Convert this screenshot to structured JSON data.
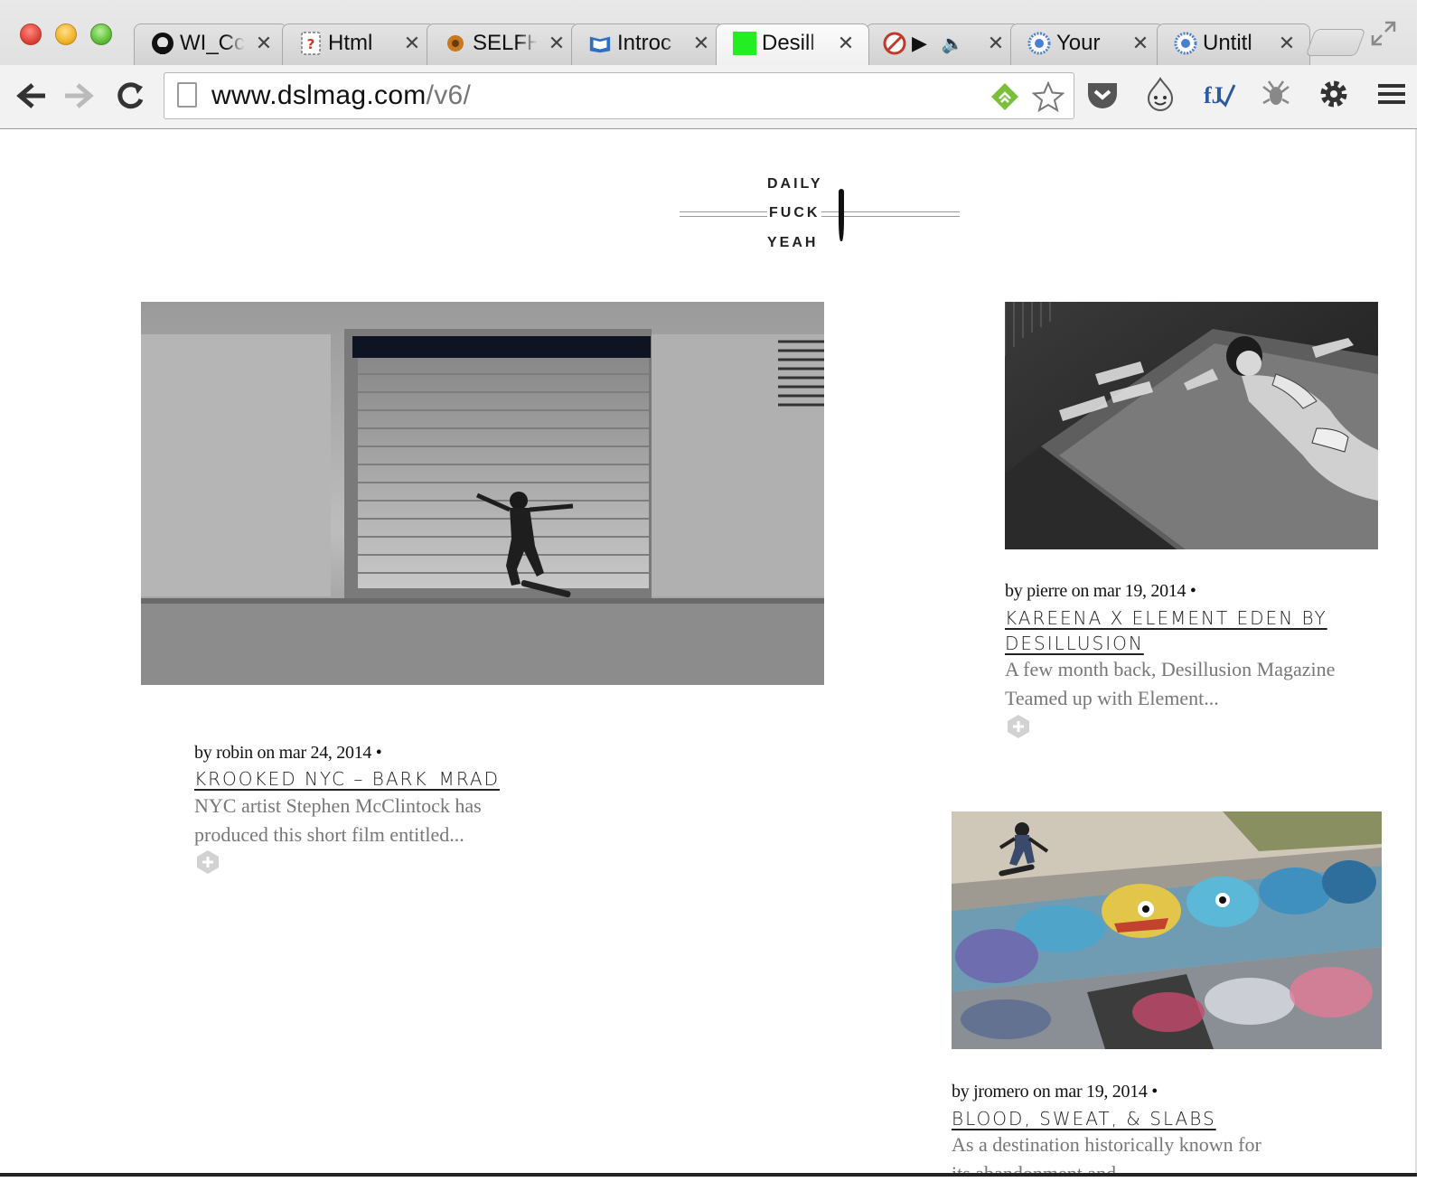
{
  "browser": {
    "tabs": [
      {
        "title": "WI_Cc",
        "icon": "github-icon"
      },
      {
        "title": "Html",
        "icon": "question-page-icon"
      },
      {
        "title": "SELFH",
        "icon": "selfhtml-icon"
      },
      {
        "title": "Introc",
        "icon": "book-icon"
      },
      {
        "title": "Desill",
        "icon": "green-square-icon"
      },
      {
        "title": "",
        "icon": "stop-icon"
      },
      {
        "title": "Your",
        "icon": "blue-circle-icon"
      },
      {
        "title": "Untitl",
        "icon": "blue-circle-icon"
      }
    ],
    "active_tab_index": 4,
    "close_glyph": "✕",
    "url_host": "www.dslmag.com",
    "url_path": "/v6/"
  },
  "site": {
    "logo_lines": [
      "DAILY",
      "FUCK",
      "YEAH"
    ]
  },
  "posts": [
    {
      "meta": "by robin on mar 24, 2014 •",
      "title": "KROOKED NYC – BARK_MRAD",
      "excerpt": "NYC artist Stephen McClintock has produced this short film entitled...",
      "image": "skater-garage-door-photo"
    },
    {
      "meta": "by pierre on mar 19, 2014 •",
      "title": "KAREENA X ELEMENT EDEN BY DESILLUSION",
      "excerpt": "A few month back, Desillusion Magazine Teamed up with Element...",
      "image": "woman-on-bed-photo"
    },
    {
      "meta": "by jromero on mar 19, 2014 •",
      "title": "BLOOD, SWEAT, & SLABS",
      "excerpt": "As a destination historically known for its abandonment and",
      "image": "graffiti-skatepark-photo"
    }
  ]
}
